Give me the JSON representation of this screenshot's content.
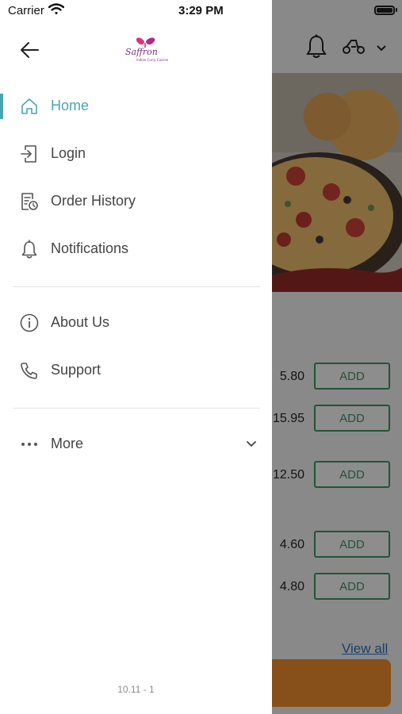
{
  "status_bar": {
    "carrier": "Carrier",
    "time": "3:29 PM"
  },
  "drawer": {
    "back_icon": "arrow-left-icon",
    "logo": {
      "text": "Saffron",
      "tagline": "Indian Curry Cuisine"
    },
    "active_color": "#4aa3b5",
    "items": [
      {
        "label": "Home",
        "icon": "home-icon",
        "active": true
      },
      {
        "label": "Login",
        "icon": "login-icon"
      },
      {
        "label": "Order History",
        "icon": "order-history-icon"
      },
      {
        "label": "Notifications",
        "icon": "bell-icon"
      },
      {
        "label": "About Us",
        "icon": "info-icon"
      },
      {
        "label": "Support",
        "icon": "phone-icon"
      },
      {
        "label": "More",
        "icon": "more-dots-icon",
        "expand_icon": "chevron-down-icon"
      }
    ],
    "version": "10.11 - 1"
  },
  "background": {
    "rows": [
      {
        "price": "5.80",
        "button": "ADD"
      },
      {
        "price": "15.95",
        "button": "ADD"
      },
      {
        "price": "12.50",
        "button": "ADD"
      },
      {
        "price": "4.60",
        "button": "ADD"
      },
      {
        "price": "4.80",
        "button": "ADD"
      }
    ],
    "view_all": "View all",
    "accent_green": "#3f8f5d",
    "cart_color": "#e8892b"
  }
}
